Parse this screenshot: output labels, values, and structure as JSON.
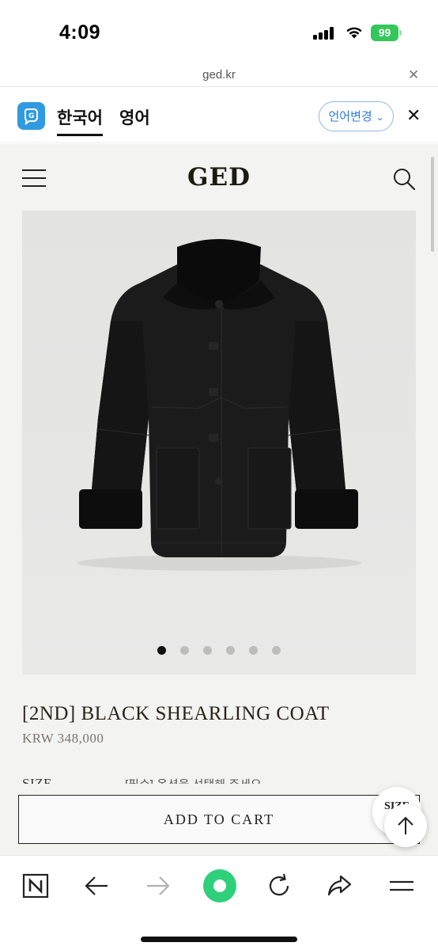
{
  "status_bar": {
    "time": "4:09",
    "battery": "99"
  },
  "browser": {
    "url": "ged.kr",
    "url_close_icon": "close-icon"
  },
  "translate_bar": {
    "tab_korean": "한국어",
    "tab_english": "영어",
    "change_language": "언어변경"
  },
  "site": {
    "logo": "GED",
    "product": {
      "title": "[2ND] BLACK SHEARLING COAT",
      "price": "KRW 348,000",
      "size_label": "SIZE",
      "size_note": "[필수] 옵션을 선택해 주세요"
    },
    "carousel": {
      "count": 6,
      "active": 0
    },
    "add_to_cart": "ADD TO CART",
    "floating_label": "SIZE"
  },
  "toolbar": {
    "icons": [
      "naver-icon",
      "back-arrow-icon",
      "forward-arrow-icon",
      "green-dot-icon",
      "reload-icon",
      "share-icon",
      "menu-icon"
    ]
  },
  "colors": {
    "accent_blue": "#2f7bd6",
    "battery_green": "#34c759",
    "toolbar_green": "#2fd07a"
  }
}
